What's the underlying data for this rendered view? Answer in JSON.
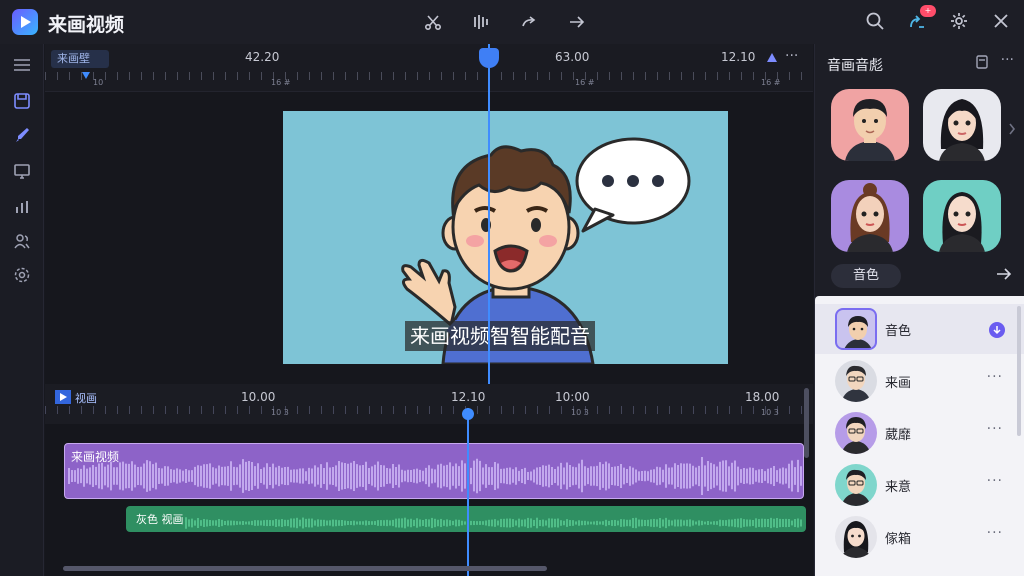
{
  "app": {
    "title": "来画视频"
  },
  "colors": {
    "accent": "#3f8cff",
    "voice_track": "#8d63c8",
    "bg_track": "#2f8f62",
    "preview_bg": "#7ec4d6"
  },
  "toolbar": {
    "center_icons": [
      "cut-icon",
      "split-icon",
      "redo-icon",
      "forward-icon"
    ],
    "right_icons": [
      "search-icon",
      "share-icon",
      "gear-icon",
      "close-icon"
    ],
    "notification_count": "+"
  },
  "rail": {
    "icons": [
      "menu-icon",
      "save-icon",
      "brush-icon",
      "monitor-icon",
      "chart-icon",
      "users-icon",
      "settings-icon"
    ]
  },
  "ruler_top": {
    "chip": "来画壁",
    "labels": [
      "42.20",
      "63.00",
      "12.10"
    ],
    "sub_labels": [
      "10",
      "16 #",
      "16 #",
      "16 #"
    ]
  },
  "preview": {
    "subtitle": "来画视频智智能配音"
  },
  "timeline": {
    "chip": "视画",
    "labels": [
      "10.00",
      "12.10",
      "10:00",
      "18.00"
    ],
    "sub_labels": [
      "10 3",
      "10 3",
      "10 3"
    ],
    "voice_track_label": "来画视频",
    "bg_track_label": "灰色 视画"
  },
  "panel": {
    "title": "音画音彪",
    "tab_label": "音色",
    "voices": [
      {
        "name": "音色",
        "selected": true
      },
      {
        "name": "来画",
        "selected": false
      },
      {
        "name": "葳靡",
        "selected": false
      },
      {
        "name": "来意",
        "selected": false
      },
      {
        "name": "傢箱",
        "selected": false
      }
    ]
  }
}
